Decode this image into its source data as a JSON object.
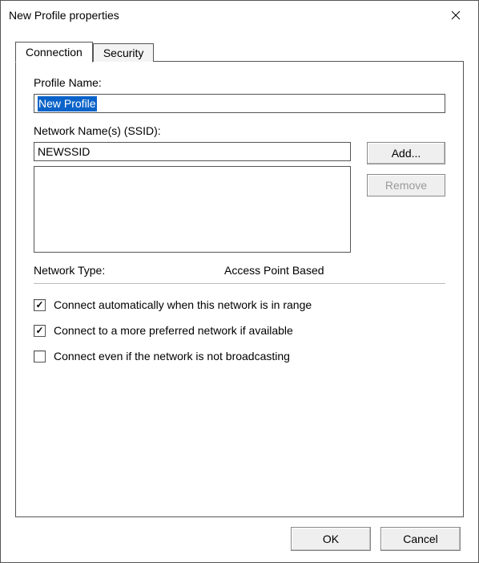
{
  "window": {
    "title": "New Profile properties"
  },
  "tabs": {
    "connection": "Connection",
    "security": "Security"
  },
  "profileName": {
    "label": "Profile Name:",
    "value": "New Profile"
  },
  "ssid": {
    "label": "Network Name(s) (SSID):",
    "value": "NEWSSID",
    "addLabel": "Add...",
    "removeLabel": "Remove"
  },
  "networkType": {
    "label": "Network Type:",
    "value": "Access Point Based"
  },
  "checks": {
    "autoConnect": {
      "label": "Connect automatically when this network is in range",
      "checked": true
    },
    "preferred": {
      "label": "Connect to a more preferred network if available",
      "checked": true
    },
    "hidden": {
      "label": "Connect even if the network is not broadcasting",
      "checked": false
    }
  },
  "buttons": {
    "ok": "OK",
    "cancel": "Cancel"
  }
}
